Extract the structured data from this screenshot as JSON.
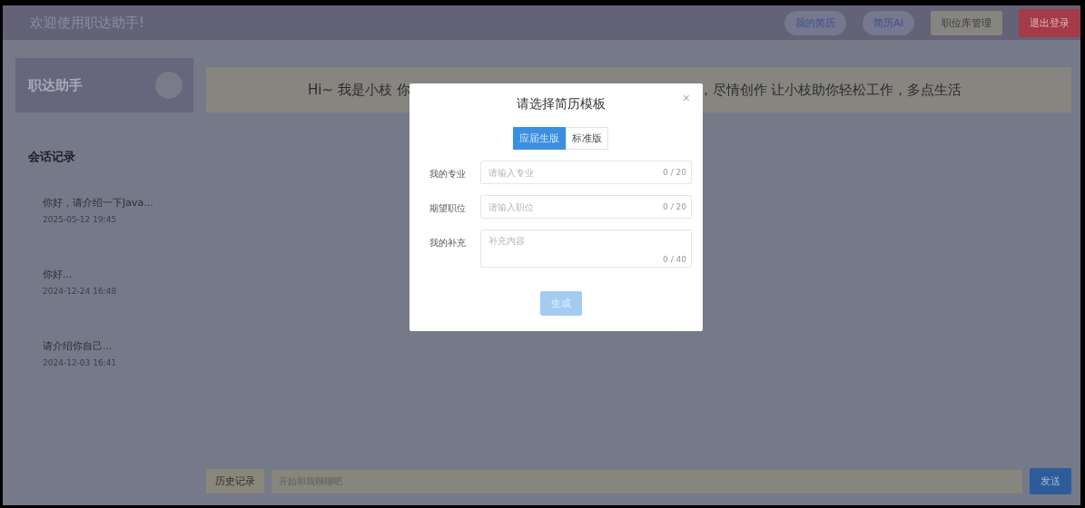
{
  "header": {
    "title": "欢迎使用职达助手!",
    "buttons": [
      {
        "label": "我的简历",
        "kind": "pill"
      },
      {
        "label": "简历AI",
        "kind": "pill"
      },
      {
        "label": "职位库管理",
        "kind": "plain"
      },
      {
        "label": "退出登录",
        "kind": "danger"
      }
    ]
  },
  "sidebar": {
    "logo": "职达助手",
    "history_title": "会话记录",
    "sessions": [
      {
        "title": "你好，请介绍一下Java...",
        "time": "2025-05-12 19:45"
      },
      {
        "title": "你好...",
        "time": "2024-12-24 16:48"
      },
      {
        "title": "请介绍你自己...",
        "time": "2024-12-03 16:41"
      }
    ]
  },
  "greeting": {
    "left": "Hi~ 我是小枝 你",
    "right": "，尽情创作 让小枝助你轻松工作，多点生活"
  },
  "chat_bar": {
    "history_button": "历史记录",
    "placeholder": "开始和我聊聊吧",
    "send_button": "发送"
  },
  "dialog": {
    "title": "请选择简历模板",
    "close": "×",
    "templates": [
      {
        "label": "应届生版",
        "selected": true
      },
      {
        "label": "标准版",
        "selected": false
      }
    ],
    "fields": [
      {
        "label": "我的专业",
        "kind": "input",
        "placeholder": "请输入专业",
        "count": "0 / 20"
      },
      {
        "label": "期望职位",
        "kind": "input",
        "placeholder": "请输入职位",
        "count": "0 / 20"
      },
      {
        "label": "我的补充",
        "kind": "textarea",
        "placeholder": "补充内容",
        "count": "0 / 40"
      }
    ],
    "submit": {
      "label": "生成",
      "disabled": true
    }
  }
}
